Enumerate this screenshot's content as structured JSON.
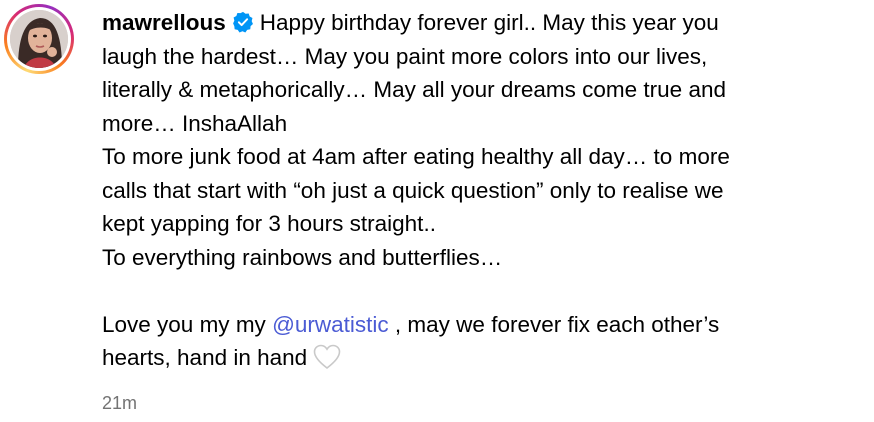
{
  "comment": {
    "username": "mawrellous",
    "verified_icon": "verified-badge-icon",
    "avatar_icon": "profile-avatar",
    "lines": [
      "Happy birthday forever girl.. May this year you",
      "laugh the hardest… May you paint more colors into our lives,",
      "literally & metaphorically… May all your dreams come true and",
      "more… InshaAllah",
      "To more junk food at 4am after eating healthy all day… to more",
      "calls that start with “oh just a quick question” only to realise we",
      "kept yapping for 3 hours straight..",
      "To everything rainbows and butterflies…"
    ],
    "love_prefix": "Love you my my ",
    "mention": "@urwatistic",
    "love_suffix": " , may we forever fix each other’s",
    "last_line": "hearts, hand in hand",
    "emoji": "white-heart-icon",
    "timestamp": "21m"
  },
  "colors": {
    "mention": "#4b5bd4",
    "verified": "#0095f6",
    "timestamp": "#737373"
  }
}
